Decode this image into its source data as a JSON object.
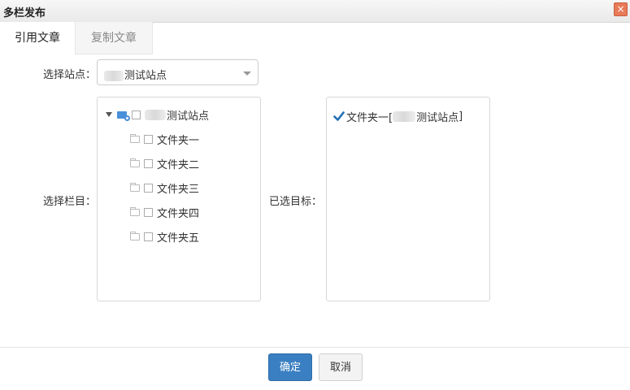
{
  "dialog": {
    "title": "多栏发布",
    "close_symbol": "×"
  },
  "tabs": [
    {
      "label": "引用文章",
      "active": true
    },
    {
      "label": "复制文章",
      "active": false
    }
  ],
  "site": {
    "label": "选择站点：",
    "value": "测试站点"
  },
  "columns": {
    "label": "选择栏目：",
    "root": {
      "label": "测试站点",
      "checked": false,
      "expanded": true
    },
    "folders": [
      {
        "label": "文件夹一",
        "checked": false
      },
      {
        "label": "文件夹二",
        "checked": false
      },
      {
        "label": "文件夹三",
        "checked": false
      },
      {
        "label": "文件夹四",
        "checked": false
      },
      {
        "label": "文件夹五",
        "checked": false
      }
    ]
  },
  "targets": {
    "label": "已选目标：",
    "items": [
      {
        "prefix": "文件夹一[",
        "site": "测试站点",
        "suffix": "]",
        "checked": true
      }
    ]
  },
  "buttons": {
    "confirm": "确定",
    "cancel": "取消"
  },
  "colors": {
    "primary": "#3a7fc1",
    "check": "#1f6fb5",
    "close": "#e87a59"
  }
}
